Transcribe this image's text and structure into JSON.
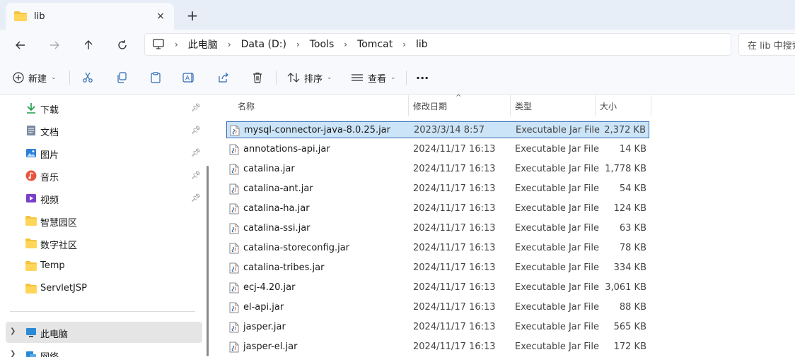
{
  "tab": {
    "title": "lib",
    "close_icon": "×",
    "new_tab_icon": "+"
  },
  "nav": {
    "breadcrumb": [
      "此电脑",
      "Data (D:)",
      "Tools",
      "Tomcat",
      "lib"
    ],
    "search_placeholder": "在 lib 中搜索"
  },
  "toolbar": {
    "new_label": "新建",
    "sort_label": "排序",
    "view_label": "查看",
    "more_label": "···"
  },
  "sidebar": {
    "quick": [
      {
        "label": "下载",
        "icon": "download-icon",
        "pinned": true
      },
      {
        "label": "文档",
        "icon": "document-icon",
        "pinned": true
      },
      {
        "label": "图片",
        "icon": "pictures-icon",
        "pinned": true
      },
      {
        "label": "音乐",
        "icon": "music-icon",
        "pinned": true
      },
      {
        "label": "视频",
        "icon": "video-icon",
        "pinned": true
      },
      {
        "label": "智慧园区",
        "icon": "folder-icon",
        "pinned": false
      },
      {
        "label": "数字社区",
        "icon": "folder-icon",
        "pinned": false
      },
      {
        "label": "Temp",
        "icon": "folder-icon",
        "pinned": false
      },
      {
        "label": "ServletJSP",
        "icon": "folder-icon",
        "pinned": false
      }
    ],
    "this_pc": "此电脑",
    "network": "网络"
  },
  "columns": {
    "name": "名称",
    "date": "修改日期",
    "type": "类型",
    "size": "大小"
  },
  "files": [
    {
      "name": "mysql-connector-java-8.0.25.jar",
      "date": "2023/3/14 8:57",
      "type": "Executable Jar File",
      "size": "2,372 KB",
      "selected": true
    },
    {
      "name": "annotations-api.jar",
      "date": "2024/11/17 16:13",
      "type": "Executable Jar File",
      "size": "14 KB"
    },
    {
      "name": "catalina.jar",
      "date": "2024/11/17 16:13",
      "type": "Executable Jar File",
      "size": "1,778 KB"
    },
    {
      "name": "catalina-ant.jar",
      "date": "2024/11/17 16:13",
      "type": "Executable Jar File",
      "size": "54 KB"
    },
    {
      "name": "catalina-ha.jar",
      "date": "2024/11/17 16:13",
      "type": "Executable Jar File",
      "size": "124 KB"
    },
    {
      "name": "catalina-ssi.jar",
      "date": "2024/11/17 16:13",
      "type": "Executable Jar File",
      "size": "63 KB"
    },
    {
      "name": "catalina-storeconfig.jar",
      "date": "2024/11/17 16:13",
      "type": "Executable Jar File",
      "size": "78 KB"
    },
    {
      "name": "catalina-tribes.jar",
      "date": "2024/11/17 16:13",
      "type": "Executable Jar File",
      "size": "334 KB"
    },
    {
      "name": "ecj-4.20.jar",
      "date": "2024/11/17 16:13",
      "type": "Executable Jar File",
      "size": "3,061 KB"
    },
    {
      "name": "el-api.jar",
      "date": "2024/11/17 16:13",
      "type": "Executable Jar File",
      "size": "88 KB"
    },
    {
      "name": "jasper.jar",
      "date": "2024/11/17 16:13",
      "type": "Executable Jar File",
      "size": "565 KB"
    },
    {
      "name": "jasper-el.jar",
      "date": "2024/11/17 16:13",
      "type": "Executable Jar File",
      "size": "172 KB"
    }
  ],
  "colors": {
    "accent": "#2d6ab3",
    "selection": "#cce4f7",
    "folder": "#f5c43c",
    "tabbar": "#e8eef7"
  }
}
